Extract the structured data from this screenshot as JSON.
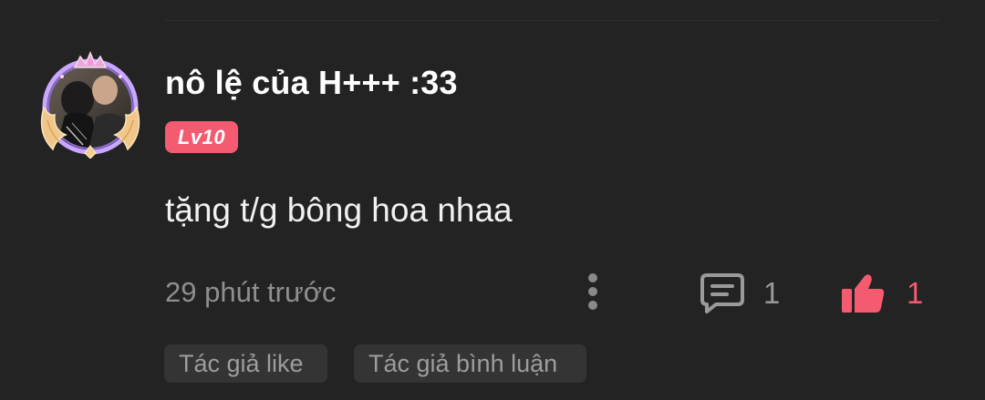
{
  "comment": {
    "username": "nô lệ của H+++ :33",
    "level_badge": "Lv10",
    "text": "tặng t/g bông hoa nhaa",
    "timestamp": "29 phút trước",
    "reply_count": "1",
    "like_count": "1",
    "tags": [
      "Tác giả like",
      "Tác giả bình luận"
    ]
  },
  "icons": {
    "avatar_frame": "crown-wings-frame",
    "more": "more-vertical-icon",
    "reply": "comment-icon",
    "like": "thumbs-up-icon"
  },
  "colors": {
    "background": "#232323",
    "accent": "#f45b70",
    "muted_text": "#8f8f8f",
    "tag_background": "#343434"
  }
}
